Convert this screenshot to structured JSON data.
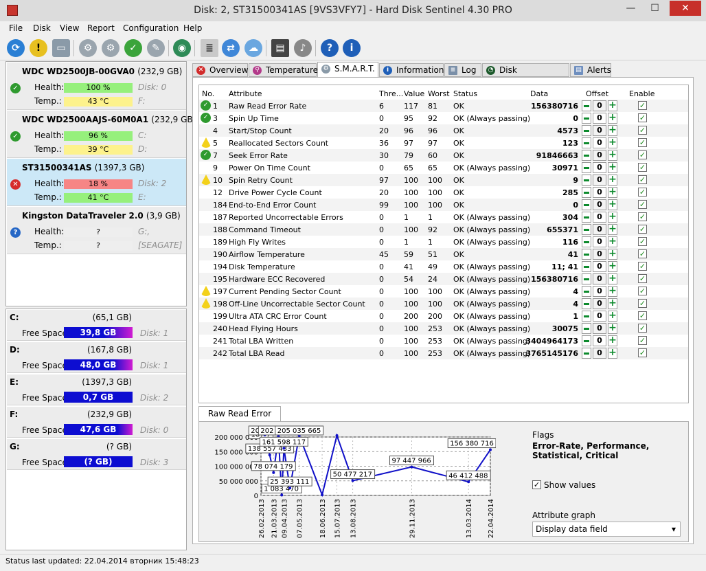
{
  "window": {
    "title": "Disk: 2, ST31500341AS [9VS3VFY7]  -  Hard Disk Sentinel 4.30 PRO",
    "minimize": "—",
    "maximize": "☐",
    "close": "✕"
  },
  "menu": [
    "File",
    "Disk",
    "View",
    "Report",
    "Configuration",
    "Help"
  ],
  "disks": [
    {
      "name": "WDC WD2500JB-00GVA0",
      "size": "(232,9 GB)",
      "health_label": "Health:",
      "health": "100 %",
      "health_value": 100,
      "temp_label": "Temp.:",
      "temp": "43 °C",
      "disk_label": "Disk: 0",
      "drive": "F:",
      "status": "ok"
    },
    {
      "name": "WDC WD2500AAJS-60M0A1",
      "size": "(232,9 GB)",
      "health_label": "Health:",
      "health": "96 %",
      "health_value": 96,
      "temp_label": "Temp.:",
      "temp": "39 °C",
      "disk_label": "C:",
      "drive": "D:",
      "status": "ok"
    },
    {
      "name": "ST31500341AS",
      "size": "(1397,3 GB)",
      "health_label": "Health:",
      "health": "18 %",
      "health_value": 18,
      "temp_label": "Temp.:",
      "temp": "41 °C",
      "disk_label": "Disk: 2",
      "drive": "E:",
      "status": "err"
    },
    {
      "name": "Kingston DataTraveler 2.0",
      "size": "(3,9 GB)",
      "health_label": "Health:",
      "health": "?",
      "health_value": 0,
      "temp_label": "Temp.:",
      "temp": "?",
      "disk_label": "Disk: 3",
      "drive": "G:,",
      "drive2": "[SEAGATE]",
      "status": "unk"
    }
  ],
  "partitions": [
    {
      "letter": "C:",
      "size": "(65,1 GB)",
      "free_label": "Free Space",
      "free": "39,8 GB",
      "disk": "Disk: 1"
    },
    {
      "letter": "D:",
      "size": "(167,8 GB)",
      "free_label": "Free Space",
      "free": "48,0 GB",
      "disk": "Disk: 1"
    },
    {
      "letter": "E:",
      "size": "(1397,3 GB)",
      "free_label": "Free Space",
      "free": "0,7 GB",
      "disk": "Disk: 2"
    },
    {
      "letter": "F:",
      "size": "(232,9 GB)",
      "free_label": "Free Space",
      "free": "47,6 GB",
      "disk": "Disk: 0"
    },
    {
      "letter": "G:",
      "size": "(? GB)",
      "free_label": "Free Space",
      "free": "(? GB)",
      "disk": "Disk: 3"
    }
  ],
  "tabs": [
    "Overview",
    "Temperature",
    "S.M.A.R.T.",
    "Information",
    "Log",
    "Disk Performance",
    "Alerts"
  ],
  "table": {
    "headers": [
      "No.",
      "Attribute",
      "Thre...",
      "Value",
      "Worst",
      "Status",
      "Data",
      "Offset",
      "Enable"
    ],
    "rows": [
      {
        "no": "1",
        "attr": "Raw Read Error Rate",
        "thr": "6",
        "val": "117",
        "worst": "81",
        "status": "OK",
        "data": "156380716",
        "offset": "0",
        "icon": "ok"
      },
      {
        "no": "3",
        "attr": "Spin Up Time",
        "thr": "0",
        "val": "95",
        "worst": "92",
        "status": "OK (Always passing)",
        "data": "0",
        "offset": "0",
        "icon": "ok"
      },
      {
        "no": "4",
        "attr": "Start/Stop Count",
        "thr": "20",
        "val": "96",
        "worst": "96",
        "status": "OK",
        "data": "4573",
        "offset": "0",
        "icon": ""
      },
      {
        "no": "5",
        "attr": "Reallocated Sectors Count",
        "thr": "36",
        "val": "97",
        "worst": "97",
        "status": "OK",
        "data": "123",
        "offset": "0",
        "icon": "warn"
      },
      {
        "no": "7",
        "attr": "Seek Error Rate",
        "thr": "30",
        "val": "79",
        "worst": "60",
        "status": "OK",
        "data": "91846663",
        "offset": "0",
        "icon": "ok"
      },
      {
        "no": "9",
        "attr": "Power On Time Count",
        "thr": "0",
        "val": "65",
        "worst": "65",
        "status": "OK (Always passing)",
        "data": "30971",
        "offset": "0",
        "icon": ""
      },
      {
        "no": "10",
        "attr": "Spin Retry Count",
        "thr": "97",
        "val": "100",
        "worst": "100",
        "status": "OK",
        "data": "9",
        "offset": "0",
        "icon": "warn"
      },
      {
        "no": "12",
        "attr": "Drive Power Cycle Count",
        "thr": "20",
        "val": "100",
        "worst": "100",
        "status": "OK",
        "data": "285",
        "offset": "0",
        "icon": ""
      },
      {
        "no": "184",
        "attr": "End-to-End Error Count",
        "thr": "99",
        "val": "100",
        "worst": "100",
        "status": "OK",
        "data": "0",
        "offset": "0",
        "icon": ""
      },
      {
        "no": "187",
        "attr": "Reported Uncorrectable Errors",
        "thr": "0",
        "val": "1",
        "worst": "1",
        "status": "OK (Always passing)",
        "data": "304",
        "offset": "0",
        "icon": ""
      },
      {
        "no": "188",
        "attr": "Command Timeout",
        "thr": "0",
        "val": "100",
        "worst": "92",
        "status": "OK (Always passing)",
        "data": "655371",
        "offset": "0",
        "icon": ""
      },
      {
        "no": "189",
        "attr": "High Fly Writes",
        "thr": "0",
        "val": "1",
        "worst": "1",
        "status": "OK (Always passing)",
        "data": "116",
        "offset": "0",
        "icon": ""
      },
      {
        "no": "190",
        "attr": "Airflow Temperature",
        "thr": "45",
        "val": "59",
        "worst": "51",
        "status": "OK",
        "data": "41",
        "offset": "0",
        "icon": ""
      },
      {
        "no": "194",
        "attr": "Disk Temperature",
        "thr": "0",
        "val": "41",
        "worst": "49",
        "status": "OK (Always passing)",
        "data": "11; 41",
        "offset": "0",
        "icon": ""
      },
      {
        "no": "195",
        "attr": "Hardware ECC Recovered",
        "thr": "0",
        "val": "54",
        "worst": "24",
        "status": "OK (Always passing)",
        "data": "156380716",
        "offset": "0",
        "icon": ""
      },
      {
        "no": "197",
        "attr": "Current Pending Sector Count",
        "thr": "0",
        "val": "100",
        "worst": "100",
        "status": "OK (Always passing)",
        "data": "4",
        "offset": "0",
        "icon": "warn"
      },
      {
        "no": "198",
        "attr": "Off-Line Uncorrectable Sector Count",
        "thr": "0",
        "val": "100",
        "worst": "100",
        "status": "OK (Always passing)",
        "data": "4",
        "offset": "0",
        "icon": "warn"
      },
      {
        "no": "199",
        "attr": "Ultra ATA CRC Error Count",
        "thr": "0",
        "val": "200",
        "worst": "200",
        "status": "OK (Always passing)",
        "data": "1",
        "offset": "0",
        "icon": ""
      },
      {
        "no": "240",
        "attr": "Head Flying Hours",
        "thr": "0",
        "val": "100",
        "worst": "253",
        "status": "OK (Always passing)",
        "data": "30075",
        "offset": "0",
        "icon": ""
      },
      {
        "no": "241",
        "attr": "Total LBA Written",
        "thr": "0",
        "val": "100",
        "worst": "253",
        "status": "OK (Always passing)",
        "data": "3404964173",
        "offset": "0",
        "icon": ""
      },
      {
        "no": "242",
        "attr": "Total LBA Read",
        "thr": "0",
        "val": "100",
        "worst": "253",
        "status": "OK (Always passing)",
        "data": "3765145176",
        "offset": "0",
        "icon": ""
      }
    ]
  },
  "graph": {
    "tab": "Raw Read Error Rate",
    "flags_label": "Flags",
    "flags_value": "Error-Rate, Performance, Statistical, Critical",
    "show_values_label": "Show values",
    "ag_label": "Attribute graph",
    "ag_value": "Display data field",
    "line_color": "#1010c8"
  },
  "chart_data": {
    "type": "line",
    "ylim": [
      0,
      200000000
    ],
    "yticks": [
      {
        "v": 0,
        "label": "0"
      },
      {
        "v": 50000000,
        "label": "50 000 000"
      },
      {
        "v": 100000000,
        "label": "100 000 000"
      },
      {
        "v": 150000000,
        "label": "150 000 000"
      },
      {
        "v": 200000000,
        "label": "200 000 000"
      }
    ],
    "x": [
      "26.02.2013",
      "21.03.2013",
      "09.04.2013",
      "07.05.2013",
      "18.06.2013",
      "15.07.2013",
      "13.08.2013",
      "29.11.2013",
      "13.03.2014",
      "22.04.2014"
    ],
    "points": [
      {
        "date": "26.02.2013",
        "value": 187000000,
        "label": "187 7"
      },
      {
        "date": "05.03.2013",
        "value": 206627000,
        "label": "206 627"
      },
      {
        "date": "14.03.2013",
        "value": 138557433,
        "label": "138 557 433"
      },
      {
        "date": "21.03.2013",
        "value": 78074179,
        "label": "78 074 179"
      },
      {
        "date": "30.03.2013",
        "value": 202333000,
        "label": "202 333 1"
      },
      {
        "date": "05.04.2013",
        "value": 1083470,
        "label": "1 083 470"
      },
      {
        "date": "09.04.2013",
        "value": 161598117,
        "label": "161 598 117"
      },
      {
        "date": "20.04.2013",
        "value": 25393111,
        "label": "25 393 111"
      },
      {
        "date": "07.05.2013",
        "value": 205035665,
        "label": "205 035 665"
      },
      {
        "date": "18.06.2013",
        "value": 2000000,
        "label": ""
      },
      {
        "date": "15.07.2013",
        "value": 205000000,
        "label": ""
      },
      {
        "date": "13.08.2013",
        "value": 50477217,
        "label": "50 477 217"
      },
      {
        "date": "29.11.2013",
        "value": 97447966,
        "label": "97 447 966"
      },
      {
        "date": "13.03.2014",
        "value": 46412488,
        "label": "46 412 488"
      },
      {
        "date": "22.04.2014",
        "value": 156380716,
        "label": "156 380 716"
      }
    ]
  },
  "status": "Status last updated: 22.04.2014 вторник 15:48:23"
}
